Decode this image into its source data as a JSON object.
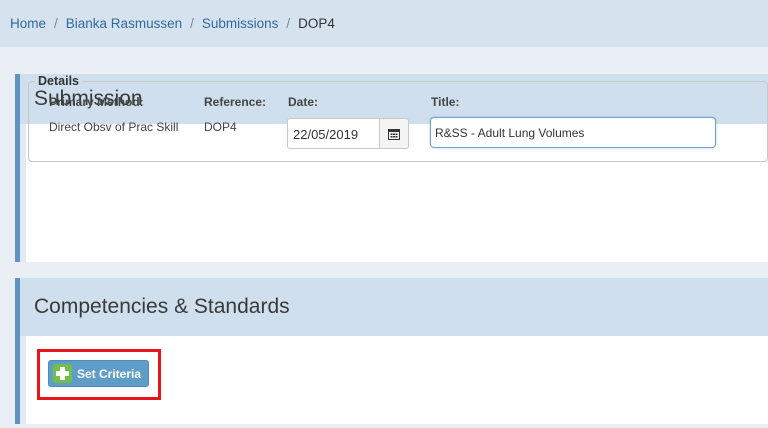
{
  "breadcrumb": {
    "items": [
      {
        "label": "Home"
      },
      {
        "label": "Bianka Rasmussen"
      },
      {
        "label": "Submissions"
      }
    ],
    "separator": "/",
    "current": "DOP4"
  },
  "submission_panel": {
    "title": "Submission",
    "details": {
      "legend": "Details",
      "primary_method_label": "Primary Method:",
      "primary_method_value": "Direct Obsv of Prac Skill",
      "reference_label": "Reference:",
      "reference_value": "DOP4",
      "date_label": "Date:",
      "date_value": "22/05/2019",
      "title_label": "Title:",
      "title_value": "R&SS - Adult Lung Volumes"
    }
  },
  "competencies_panel": {
    "title": "Competencies & Standards",
    "set_criteria_label": "Set Criteria"
  },
  "icons": {
    "calendar": "calendar-icon",
    "add": "plus-icon"
  },
  "colors": {
    "accent": "#5f93c4",
    "link": "#2f6aa0",
    "highlight": "#e8141a",
    "add_icon": "#6fbf4a"
  }
}
